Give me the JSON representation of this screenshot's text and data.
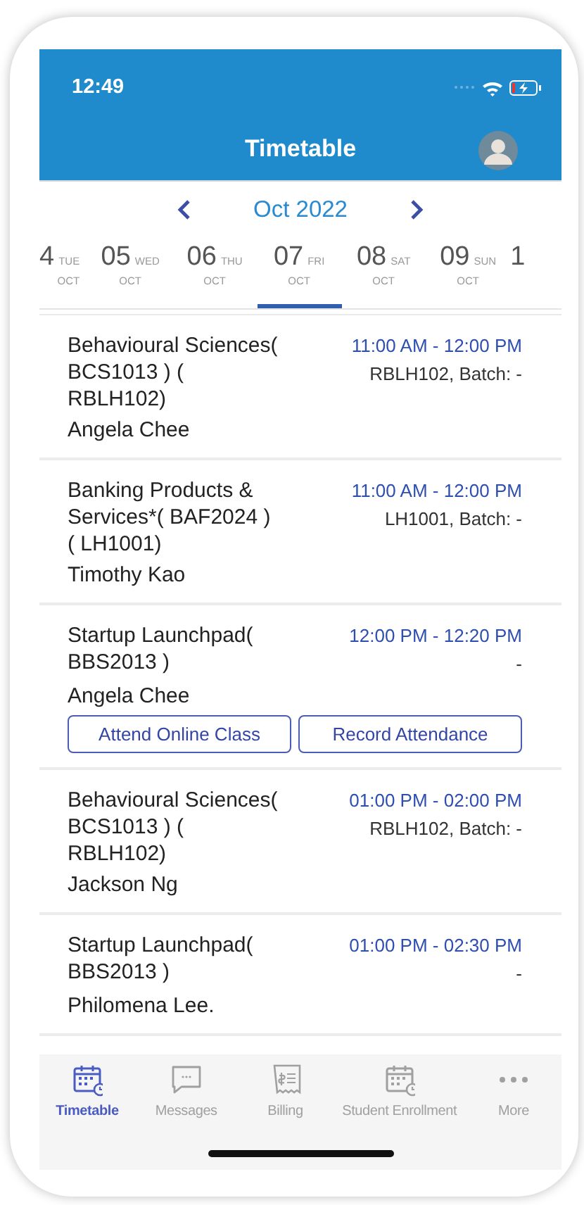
{
  "status_bar": {
    "time": "12:49"
  },
  "header": {
    "title": "Timetable"
  },
  "month_nav": {
    "label": "Oct 2022"
  },
  "days": [
    {
      "day": "4",
      "weekday": "TUE",
      "month": "OCT",
      "selected": false
    },
    {
      "day": "05",
      "weekday": "WED",
      "month": "OCT",
      "selected": false
    },
    {
      "day": "06",
      "weekday": "THU",
      "month": "OCT",
      "selected": false
    },
    {
      "day": "07",
      "weekday": "FRI",
      "month": "OCT",
      "selected": true
    },
    {
      "day": "08",
      "weekday": "SAT",
      "month": "OCT",
      "selected": false
    },
    {
      "day": "09",
      "weekday": "SUN",
      "month": "OCT",
      "selected": false
    },
    {
      "day": "1",
      "selected": false
    }
  ],
  "classes": [
    {
      "title": "Behavioural Sciences( BCS1013 ) ( RBLH102)",
      "time": "11:00 AM - 12:00 PM",
      "location": "RBLH102, Batch: -",
      "teacher": "Angela Chee"
    },
    {
      "title": "Banking Products & Services*( BAF2024 ) ( LH1001)",
      "time": "11:00 AM - 12:00 PM",
      "location": "LH1001, Batch: -",
      "teacher": "Timothy Kao"
    },
    {
      "title": "Startup Launchpad( BBS2013 )",
      "time": "12:00 PM - 12:20 PM",
      "location": "-",
      "teacher": "Angela Chee",
      "actions": [
        "Attend Online Class",
        "Record Attendance"
      ]
    },
    {
      "title": "Behavioural Sciences( BCS1013 ) ( RBLH102)",
      "time": "01:00 PM - 02:00 PM",
      "location": "RBLH102, Batch: -",
      "teacher": "Jackson Ng"
    },
    {
      "title": "Startup Launchpad( BBS2013 )",
      "time": "01:00 PM - 02:30 PM",
      "location": "-",
      "teacher": "Philomena Lee."
    }
  ],
  "tab_bar": [
    {
      "label": "Timetable",
      "kind": "calendar",
      "selected": true
    },
    {
      "label": "Messages",
      "kind": "chat",
      "selected": false
    },
    {
      "label": "Billing",
      "kind": "bill",
      "selected": false
    },
    {
      "label": "Student Enrollment",
      "kind": "calendar",
      "selected": false
    },
    {
      "label": "More",
      "kind": "dots",
      "selected": false
    }
  ]
}
